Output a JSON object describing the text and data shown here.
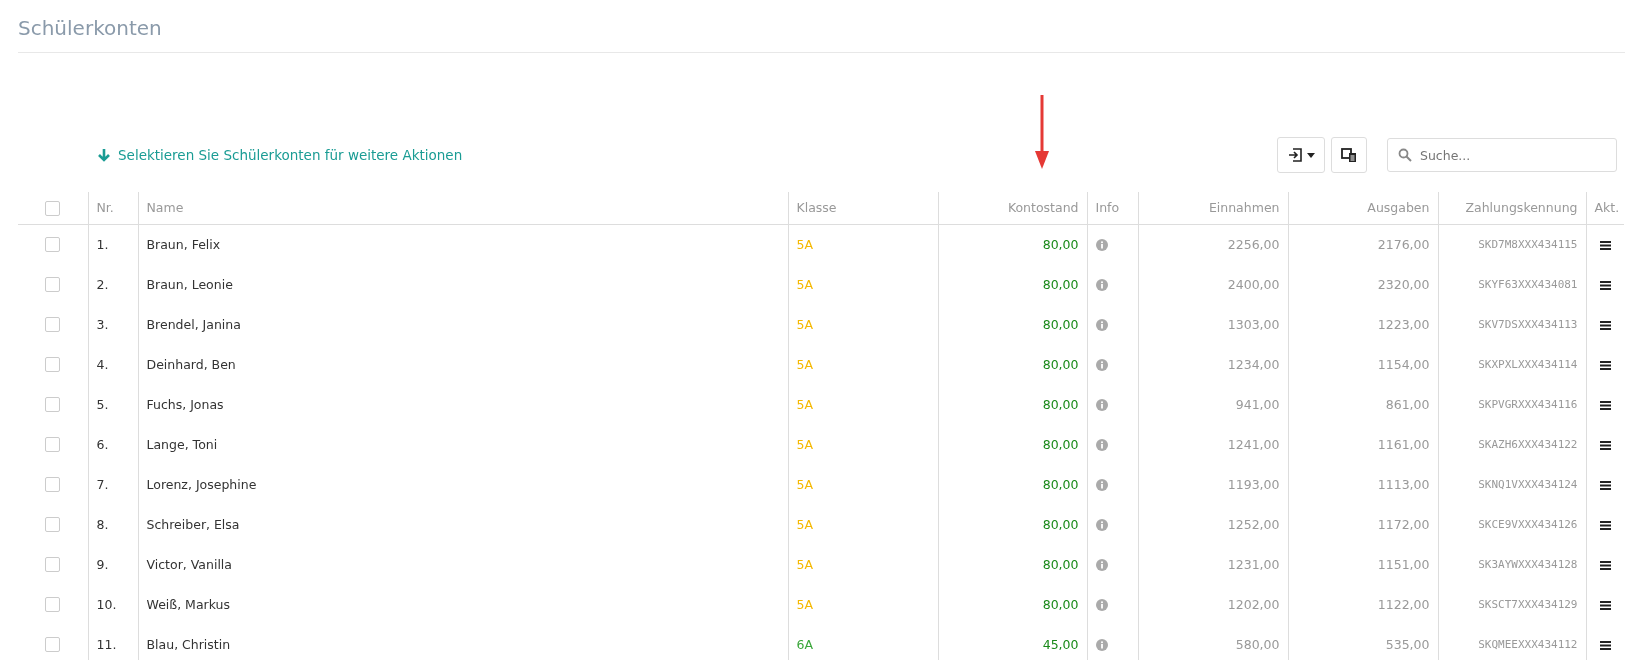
{
  "page": {
    "title": "Schülerkonten"
  },
  "toolbar": {
    "hint": "Selektieren Sie Schülerkonten für weitere Aktionen",
    "search": {
      "placeholder": "Suche..."
    }
  },
  "table": {
    "select_all": {
      "checked": false
    },
    "columns": [
      {
        "label": "Nr."
      },
      {
        "label": "Name"
      },
      {
        "label": "Klasse"
      },
      {
        "label": "Kontostand"
      },
      {
        "label": "Info"
      },
      {
        "label": "Einnahmen"
      },
      {
        "label": "Ausgaben"
      },
      {
        "label": "Zahlungskennung"
      },
      {
        "label": "Akt."
      }
    ],
    "rows": [
      {
        "checked": false,
        "nr": "1.",
        "name": "Braun, Felix",
        "klasse": "5A",
        "color": "#f5b800",
        "kontostand": "80,00",
        "einnahmen": "2256,00",
        "ausgaben": "2176,00",
        "kennung": "SKD7M8XXX434115"
      },
      {
        "checked": false,
        "nr": "2.",
        "name": "Braun, Leonie",
        "klasse": "5A",
        "color": "#f5b800",
        "kontostand": "80,00",
        "einnahmen": "2400,00",
        "ausgaben": "2320,00",
        "kennung": "SKYF63XXX434081"
      },
      {
        "checked": false,
        "nr": "3.",
        "name": "Brendel, Janina",
        "klasse": "5A",
        "color": "#f5b800",
        "kontostand": "80,00",
        "einnahmen": "1303,00",
        "ausgaben": "1223,00",
        "kennung": "SKV7DSXXX434113"
      },
      {
        "checked": false,
        "nr": "4.",
        "name": "Deinhard, Ben",
        "klasse": "5A",
        "color": "#f5b800",
        "kontostand": "80,00",
        "einnahmen": "1234,00",
        "ausgaben": "1154,00",
        "kennung": "SKXPXLXXX434114"
      },
      {
        "checked": false,
        "nr": "5.",
        "name": "Fuchs, Jonas",
        "klasse": "5A",
        "color": "#f5b800",
        "kontostand": "80,00",
        "einnahmen": "941,00",
        "ausgaben": "861,00",
        "kennung": "SKPVGRXXX434116"
      },
      {
        "checked": false,
        "nr": "6.",
        "name": "Lange, Toni",
        "klasse": "5A",
        "color": "#f5b800",
        "kontostand": "80,00",
        "einnahmen": "1241,00",
        "ausgaben": "1161,00",
        "kennung": "SKAZH6XXX434122"
      },
      {
        "checked": false,
        "nr": "7.",
        "name": "Lorenz, Josephine",
        "klasse": "5A",
        "color": "#f5b800",
        "kontostand": "80,00",
        "einnahmen": "1193,00",
        "ausgaben": "1113,00",
        "kennung": "SKNQ1VXXX434124"
      },
      {
        "checked": false,
        "nr": "8.",
        "name": "Schreiber, Elsa",
        "klasse": "5A",
        "color": "#f5b800",
        "kontostand": "80,00",
        "einnahmen": "1252,00",
        "ausgaben": "1172,00",
        "kennung": "SKCE9VXXX434126"
      },
      {
        "checked": false,
        "nr": "9.",
        "name": "Victor, Vanilla",
        "klasse": "5A",
        "color": "#f5b800",
        "kontostand": "80,00",
        "einnahmen": "1231,00",
        "ausgaben": "1151,00",
        "kennung": "SK3AYWXXX434128"
      },
      {
        "checked": false,
        "nr": "10.",
        "name": "Weiß, Markus",
        "klasse": "5A",
        "color": "#f5b800",
        "kontostand": "80,00",
        "einnahmen": "1202,00",
        "ausgaben": "1122,00",
        "kennung": "SKSCT7XXX434129"
      },
      {
        "checked": false,
        "nr": "11.",
        "name": "Blau, Christin",
        "klasse": "6A",
        "color": "#3aa63a",
        "kontostand": "45,00",
        "einnahmen": "580,00",
        "ausgaben": "535,00",
        "kennung": "SKQMEEXXX434112"
      }
    ]
  }
}
